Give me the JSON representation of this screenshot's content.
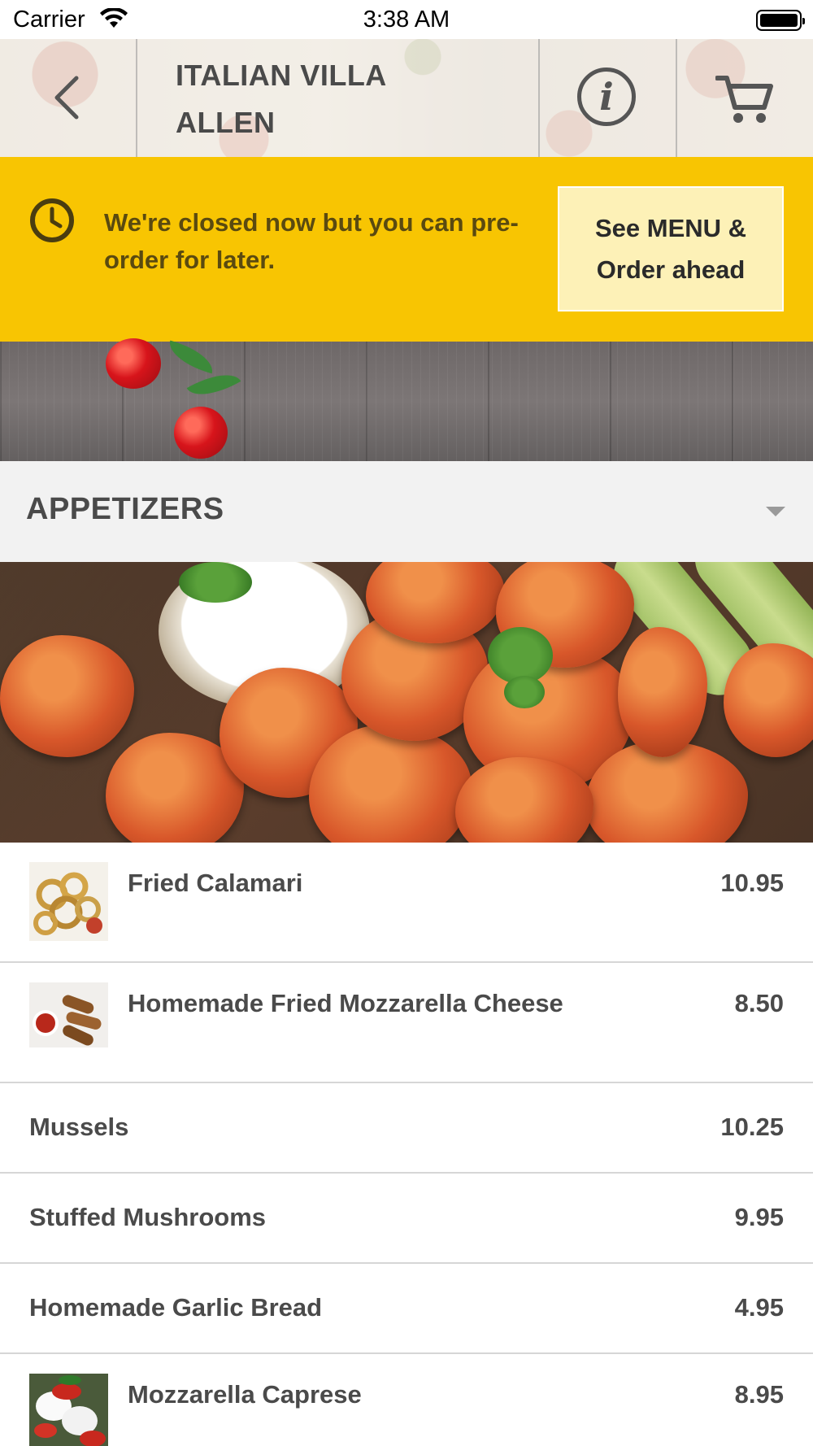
{
  "status_bar": {
    "carrier": "Carrier",
    "time": "3:38 AM"
  },
  "header": {
    "title_line1": "ITALIAN VILLA",
    "title_line2": "ALLEN"
  },
  "banner": {
    "message": "We're closed now but you can pre-order for later.",
    "button_line1": "See MENU &",
    "button_line2": "Order ahead",
    "color": "#f8c502"
  },
  "category": {
    "title": "APPETIZERS"
  },
  "menu": {
    "items": [
      {
        "name": "Fried Calamari",
        "price": "10.95",
        "thumbnail": "calamari"
      },
      {
        "name": "Homemade Fried Mozzarella Cheese",
        "price": "8.50",
        "thumbnail": "mozzarella-sticks"
      },
      {
        "name": "Mussels",
        "price": "10.25"
      },
      {
        "name": "Stuffed Mushrooms",
        "price": "9.95"
      },
      {
        "name": "Homemade Garlic Bread",
        "price": "4.95"
      },
      {
        "name": "Mozzarella Caprese",
        "price": "8.95",
        "thumbnail": "caprese"
      }
    ]
  },
  "icons": [
    "wifi-icon",
    "battery-icon",
    "back-chevron-icon",
    "info-icon",
    "cart-icon",
    "clock-icon",
    "chevron-down-icon"
  ]
}
